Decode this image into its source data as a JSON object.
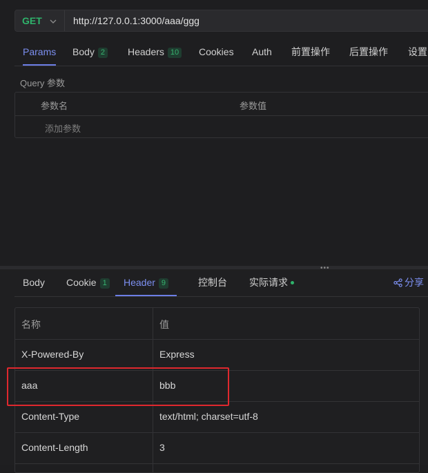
{
  "request": {
    "method": "GET",
    "url": "http://127.0.0.1:3000/aaa/ggg"
  },
  "request_tabs": [
    {
      "label": "Params",
      "active": true
    },
    {
      "label": "Body",
      "badge": "2"
    },
    {
      "label": "Headers",
      "badge": "10"
    },
    {
      "label": "Cookies"
    },
    {
      "label": "Auth"
    },
    {
      "label": "前置操作"
    },
    {
      "label": "后置操作"
    },
    {
      "label": "设置"
    }
  ],
  "query": {
    "title": "Query 参数",
    "col_name": "参数名",
    "col_value": "参数值",
    "add_placeholder": "添加参数"
  },
  "response_tabs": [
    {
      "label": "Body"
    },
    {
      "label": "Cookie",
      "badge": "1"
    },
    {
      "label": "Header",
      "badge": "9",
      "active": true
    },
    {
      "label": "控制台"
    },
    {
      "label": "实际请求",
      "dot": true
    }
  ],
  "share_label": "分享",
  "headers_table": {
    "col_name": "名称",
    "col_value": "值",
    "rows": [
      {
        "name": "X-Powered-By",
        "value": "Express"
      },
      {
        "name": "aaa",
        "value": "bbb",
        "highlighted": true
      },
      {
        "name": "Content-Type",
        "value": "text/html; charset=utf-8"
      },
      {
        "name": "Content-Length",
        "value": "3"
      }
    ]
  },
  "colors": {
    "accent": "#7c8ff0",
    "method_get": "#2fb36b",
    "badge_text": "#37b46f",
    "highlight_box": "#e0282e"
  }
}
